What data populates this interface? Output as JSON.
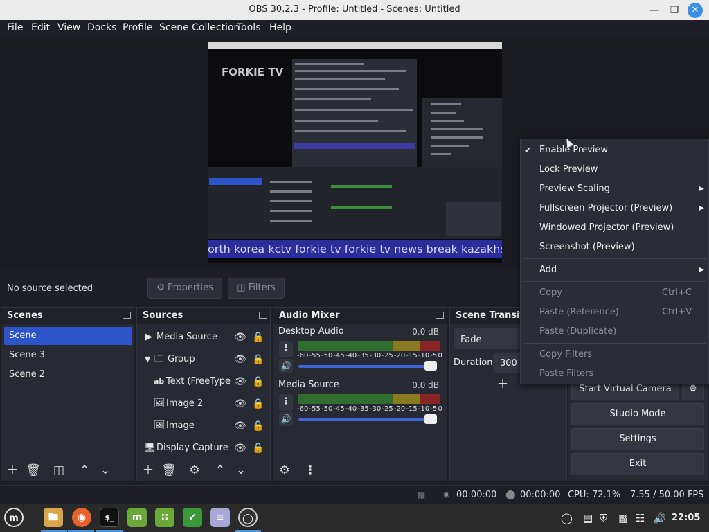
{
  "window": {
    "title": "OBS 30.2.3 - Profile: Untitled - Scenes: Untitled"
  },
  "menubar": [
    "File",
    "Edit",
    "View",
    "Docks",
    "Profile",
    "Scene Collection",
    "Tools",
    "Help"
  ],
  "preview": {
    "logo_text": "FORKIE TV",
    "ticker_text": "orth korea kctv forkie tv forkie tv news break kazakhstan"
  },
  "sourcebar": {
    "no_source": "No source selected",
    "properties_label": "Properties",
    "filters_label": "Filters"
  },
  "scenes": {
    "title": "Scenes",
    "items": [
      "Scene",
      "Scene 3",
      "Scene 2"
    ],
    "selected": "Scene"
  },
  "sources": {
    "title": "Sources",
    "items": [
      "Media Source",
      "Group",
      "Text (FreeType",
      "Image 2",
      "Image",
      "Display Capture ("
    ]
  },
  "mixer": {
    "title": "Audio Mixer",
    "channels": [
      {
        "name": "Desktop Audio",
        "db": "0.0 dB",
        "volume": 1.0
      },
      {
        "name": "Media Source",
        "db": "0.0 dB",
        "volume": 1.0
      }
    ],
    "ticks": [
      "-60",
      "-55",
      "-50",
      "-45",
      "-40",
      "-35",
      "-30",
      "-25",
      "-20",
      "-15",
      "-10",
      "-5",
      "0"
    ]
  },
  "transitions": {
    "title": "Scene Transiti",
    "type": "Fade",
    "duration_label": "Duration",
    "duration_value": "300"
  },
  "controls": {
    "virtual_camera": "Start Virtual Camera",
    "studio_mode": "Studio Mode",
    "settings": "Settings",
    "exit": "Exit"
  },
  "context_menu": {
    "enable_preview": "Enable Preview",
    "lock_preview": "Lock Preview",
    "preview_scaling": "Preview Scaling",
    "fullscreen_projector": "Fullscreen Projector (Preview)",
    "windowed_projector": "Windowed Projector (Preview)",
    "screenshot": "Screenshot (Preview)",
    "add": "Add",
    "copy": "Copy",
    "copy_shortcut": "Ctrl+C",
    "paste_reference": "Paste (Reference)",
    "paste_reference_shortcut": "Ctrl+V",
    "paste_duplicate": "Paste (Duplicate)",
    "copy_filters": "Copy Filters",
    "paste_filters": "Paste Filters"
  },
  "statusbar": {
    "stream_time": "00:00:00",
    "record_time": "00:00:00",
    "cpu": "CPU: 72.1%",
    "fps": "7.55 / 50.00 FPS"
  },
  "taskbar": {
    "clock": "22:05"
  },
  "colors": {
    "accent": "#2e54c9",
    "meter_green": "#3b8f3b",
    "meter_yellow": "#9a8a2a",
    "meter_red": "#9a2a2a"
  }
}
